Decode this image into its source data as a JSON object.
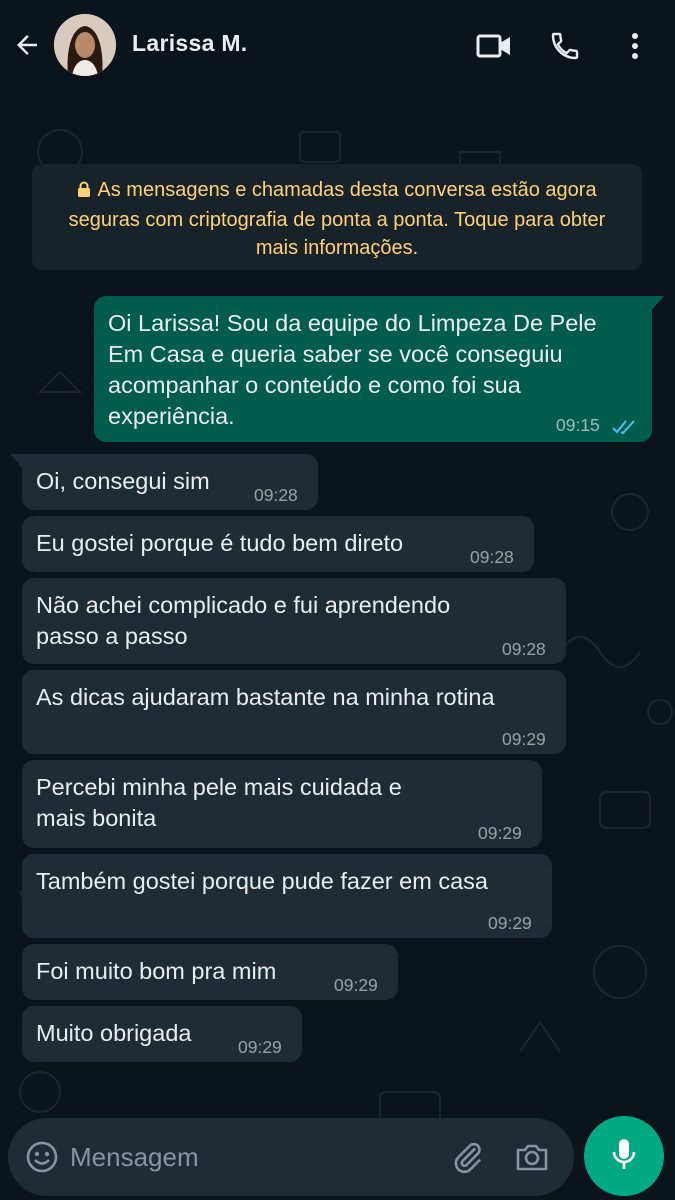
{
  "header": {
    "contact_name": "Larissa M.",
    "icons": [
      "back-arrow-icon",
      "video-call-icon",
      "phone-call-icon",
      "more-options-icon"
    ]
  },
  "encryption_notice": "As mensagens e chamadas desta conversa estão agora seguras com criptografia de ponta a ponta. Toque para obter mais informações.",
  "outgoing": {
    "text": "Oi Larissa! Sou da equipe do Limpeza De Pele Em Casa e queria saber se você conseguiu acompanhar o conteúdo e como foi sua experiência.",
    "time": "09:15",
    "status": "read"
  },
  "incoming": [
    {
      "text": "Oi, consegui sim",
      "time": "09:28"
    },
    {
      "text": "Eu gostei porque é tudo bem direto",
      "time": "09:28"
    },
    {
      "text": "Não achei complicado e fui aprendendo passo a passo",
      "time": "09:28"
    },
    {
      "text": "As dicas ajudaram bastante na minha rotina",
      "time": "09:29"
    },
    {
      "text": "Percebi minha pele mais cuidada e mais bonita",
      "time": "09:29"
    },
    {
      "text": "Também gostei porque pude fazer em casa",
      "time": "09:29"
    },
    {
      "text": "Foi muito bom pra mim",
      "time": "09:29"
    },
    {
      "text": "Muito obrigada",
      "time": "09:29"
    }
  ],
  "input": {
    "placeholder": "Mensagem"
  },
  "colors": {
    "background": "#0b141a",
    "incoming_bubble": "#202c33",
    "outgoing_bubble": "#005c4b",
    "notice_text": "#ffd279",
    "accent": "#00a884",
    "read_ticks": "#53bdeb"
  }
}
